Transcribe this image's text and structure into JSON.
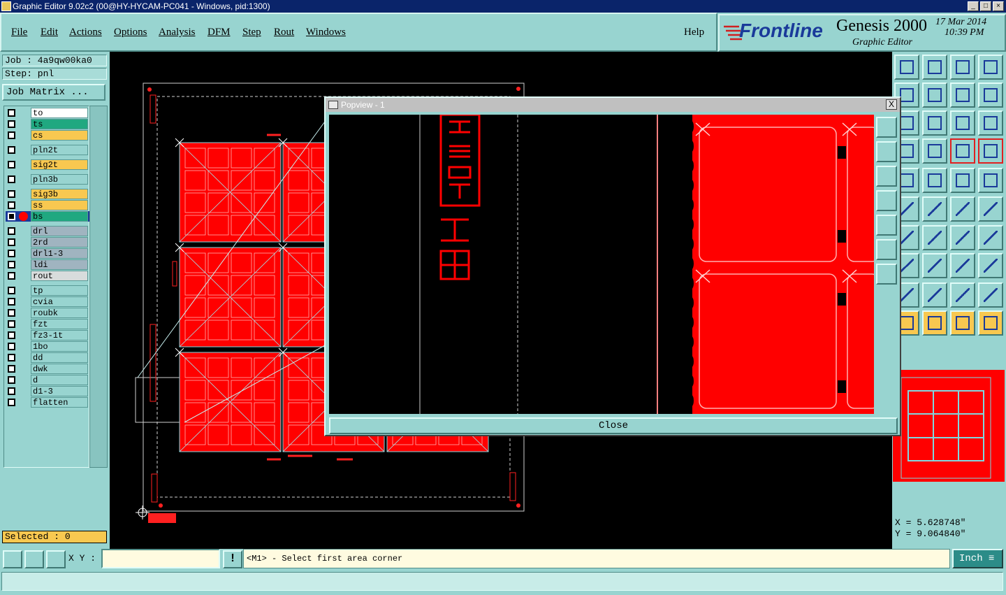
{
  "window": {
    "title": "Graphic Editor 9.02c2 (00@HY-HYCAM-PC041 - Windows, pid:1300)"
  },
  "menu": [
    {
      "label": "File"
    },
    {
      "label": "Edit"
    },
    {
      "label": "Actions"
    },
    {
      "label": "Options"
    },
    {
      "label": "Analysis"
    },
    {
      "label": "DFM"
    },
    {
      "label": "Step"
    },
    {
      "label": "Rout"
    },
    {
      "label": "Windows"
    }
  ],
  "help_label": "Help",
  "logo": {
    "brand": "Frontline",
    "product": "Genesis 2000",
    "subtitle": "Graphic Editor",
    "date": "17 Mar 2014",
    "time": "10:39 PM"
  },
  "job": {
    "job_line": "Job : 4a9qw00ka0",
    "step_line": "Step: pnl",
    "matrix_button": "Job Matrix ..."
  },
  "layers": [
    {
      "name": "to",
      "color": "#ffffff"
    },
    {
      "name": "ts",
      "color": "#20a880"
    },
    {
      "name": "cs",
      "color": "#f8c850"
    },
    {
      "name": "pln2t",
      "color": "#98d4d0"
    },
    {
      "name": "sig2t",
      "color": "#f8c850"
    },
    {
      "name": "pln3b",
      "color": "#98d4d0"
    },
    {
      "name": "sig3b",
      "color": "#f8c850"
    },
    {
      "name": "ss",
      "color": "#f8c850"
    },
    {
      "name": "bs",
      "color": "#20a880"
    },
    {
      "name": "drl",
      "color": "#a0b4c0"
    },
    {
      "name": "2rd",
      "color": "#a0b4c0"
    },
    {
      "name": "drl1-3",
      "color": "#a0b4c0"
    },
    {
      "name": "ldi",
      "color": "#a0b4c0"
    },
    {
      "name": "rout",
      "color": "#d8dcdc"
    },
    {
      "name": "tp",
      "color": "#98d4d0"
    },
    {
      "name": "cvia",
      "color": "#98d4d0"
    },
    {
      "name": "roubk",
      "color": "#98d4d0"
    },
    {
      "name": "fzt",
      "color": "#98d4d0"
    },
    {
      "name": "fz3-1t",
      "color": "#98d4d0"
    },
    {
      "name": "1bo",
      "color": "#98d4d0"
    },
    {
      "name": "dd",
      "color": "#98d4d0"
    },
    {
      "name": "dwk",
      "color": "#98d4d0"
    },
    {
      "name": "d",
      "color": "#98d4d0"
    },
    {
      "name": "d1-3",
      "color": "#98d4d0"
    },
    {
      "name": "flatten",
      "color": "#98d4d0"
    }
  ],
  "selected_text": "Selected : 0",
  "coords": {
    "x": "X = 5.628748\"",
    "y": "Y = 9.064840\""
  },
  "popview": {
    "title": "Popview - 1",
    "close_label": "Close",
    "close_x": "X"
  },
  "bottom": {
    "xy_label": "X Y :",
    "xy_value": "",
    "bang": "!",
    "message": "<M1> - Select first area corner",
    "unit": "Inch"
  },
  "colors": {
    "accent": "#98d4d0",
    "highlight": "#f8c850",
    "pcb_red": "#ff0000",
    "grid_cyan": "#7fd8e0"
  }
}
